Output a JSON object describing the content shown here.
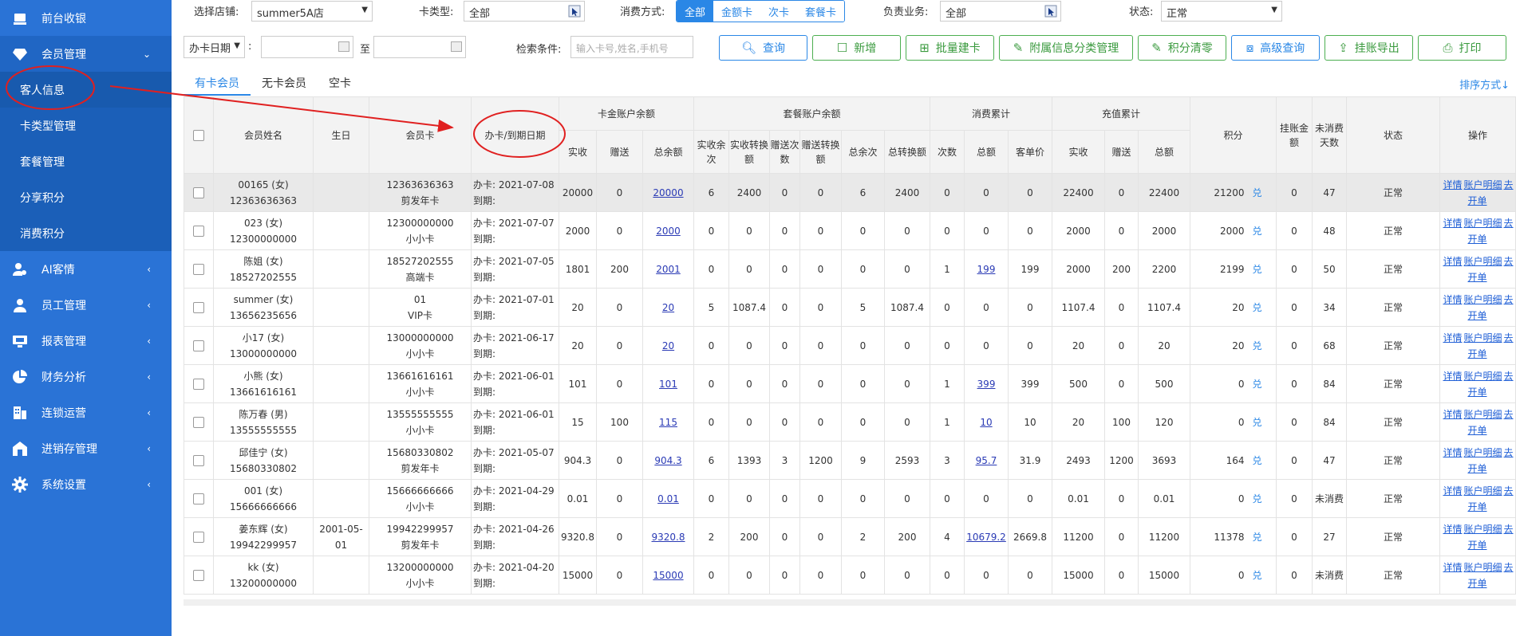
{
  "sidebar": {
    "items": [
      {
        "label": "前台收银",
        "icon": "cashier-icon"
      },
      {
        "label": "会员管理",
        "icon": "diamond-icon",
        "chev": "⌄"
      },
      {
        "label": "AI客情",
        "icon": "user-gear-icon",
        "chev": "‹"
      },
      {
        "label": "员工管理",
        "icon": "person-icon",
        "chev": "‹"
      },
      {
        "label": "报表管理",
        "icon": "monitor-icon",
        "chev": "‹"
      },
      {
        "label": "财务分析",
        "icon": "pie-icon",
        "chev": "‹"
      },
      {
        "label": "连锁运营",
        "icon": "building-icon",
        "chev": "‹"
      },
      {
        "label": "进销存管理",
        "icon": "house-icon",
        "chev": "‹"
      },
      {
        "label": "系统设置",
        "icon": "gear-icon",
        "chev": "‹"
      }
    ],
    "sub": [
      "客人信息",
      "卡类型管理",
      "套餐管理",
      "分享积分",
      "消费积分"
    ]
  },
  "filters": {
    "store_label": "选择店铺:",
    "store_value": "summer5A店",
    "cardtype_label": "卡类型:",
    "cardtype_value": "全部",
    "paymode_label": "消费方式:",
    "paymodes": [
      "全部",
      "金额卡",
      "次卡",
      "套餐卡"
    ],
    "staff_label": "负责业务:",
    "staff_value": "全部",
    "status_label": "状态:",
    "status_value": "正常",
    "date_type": "办卡日期",
    "date_colon": ":",
    "date_to": "至",
    "search_label": "检索条件:",
    "search_placeholder": "输入卡号,姓名,手机号"
  },
  "buttons": [
    "查询",
    "新增",
    "批量建卡",
    "附属信息分类管理",
    "积分清零",
    "高级查询",
    "挂账导出",
    "打印"
  ],
  "tabs": [
    "有卡会员",
    "无卡会员",
    "空卡"
  ],
  "sort_label": "排序方式↓",
  "table": {
    "h1": {
      "name": "会员姓名",
      "birth": "生日",
      "card": "会员卡",
      "date": "办卡/到期日期",
      "cardbal": "卡金账户余额",
      "pkgbal": "套餐账户余额",
      "consume": "消费累计",
      "recharge": "充值累计",
      "points": "积分",
      "credit": "挂账金额",
      "unused": "未消费天数",
      "status": "状态",
      "ops": "操作"
    },
    "h2": [
      "实收",
      "赠送",
      "总余额",
      "实收余次",
      "实收转换额",
      "赠送次数",
      "赠送转换额",
      "总余次",
      "总转换额",
      "次数",
      "总额",
      "客单价",
      "实收",
      "赠送",
      "总额"
    ],
    "date_prefix_open": "办卡:",
    "date_prefix_exp": "到期:",
    "ops": [
      "详情",
      "账户明细",
      "去开单"
    ],
    "points_suffix": "兑",
    "rows": [
      {
        "name": "00165 (女)",
        "phone": "12363636363",
        "birth": "",
        "card": "12363636363",
        "ctype": "剪发年卡",
        "open": "2021-07-08",
        "c": [
          "20000",
          "0",
          "20000",
          "6",
          "2400",
          "0",
          "0",
          "6",
          "2400",
          "0",
          "0",
          "0",
          "22400",
          "0",
          "22400"
        ],
        "pts": "21200",
        "credit": "0",
        "unused": "47",
        "status": "正常"
      },
      {
        "name": "023 (女)",
        "phone": "12300000000",
        "birth": "",
        "card": "12300000000",
        "ctype": "小小卡",
        "open": "2021-07-07",
        "c": [
          "2000",
          "0",
          "2000",
          "0",
          "0",
          "0",
          "0",
          "0",
          "0",
          "0",
          "0",
          "0",
          "2000",
          "0",
          "2000"
        ],
        "pts": "2000",
        "credit": "0",
        "unused": "48",
        "status": "正常"
      },
      {
        "name": "陈姐 (女)",
        "phone": "18527202555",
        "birth": "",
        "card": "18527202555",
        "ctype": "高端卡",
        "open": "2021-07-05",
        "c": [
          "1801",
          "200",
          "2001",
          "0",
          "0",
          "0",
          "0",
          "0",
          "0",
          "1",
          "199",
          "199",
          "2000",
          "200",
          "2200"
        ],
        "pts": "2199",
        "credit": "0",
        "unused": "50",
        "status": "正常"
      },
      {
        "name": "summer (女)",
        "phone": "13656235656",
        "birth": "",
        "card": "01",
        "ctype": "VIP卡",
        "open": "2021-07-01",
        "c": [
          "20",
          "0",
          "20",
          "5",
          "1087.4",
          "0",
          "0",
          "5",
          "1087.4",
          "0",
          "0",
          "0",
          "1107.4",
          "0",
          "1107.4"
        ],
        "pts": "20",
        "credit": "0",
        "unused": "34",
        "status": "正常"
      },
      {
        "name": "小17 (女)",
        "phone": "13000000000",
        "birth": "",
        "card": "13000000000",
        "ctype": "小小卡",
        "open": "2021-06-17",
        "c": [
          "20",
          "0",
          "20",
          "0",
          "0",
          "0",
          "0",
          "0",
          "0",
          "0",
          "0",
          "0",
          "20",
          "0",
          "20"
        ],
        "pts": "20",
        "credit": "0",
        "unused": "68",
        "status": "正常"
      },
      {
        "name": "小熊 (女)",
        "phone": "13661616161",
        "birth": "",
        "card": "13661616161",
        "ctype": "小小卡",
        "open": "2021-06-01",
        "c": [
          "101",
          "0",
          "101",
          "0",
          "0",
          "0",
          "0",
          "0",
          "0",
          "1",
          "399",
          "399",
          "500",
          "0",
          "500"
        ],
        "pts": "0",
        "credit": "0",
        "unused": "84",
        "status": "正常"
      },
      {
        "name": "陈万春 (男)",
        "phone": "13555555555",
        "birth": "",
        "card": "13555555555",
        "ctype": "小小卡",
        "open": "2021-06-01",
        "c": [
          "15",
          "100",
          "115",
          "0",
          "0",
          "0",
          "0",
          "0",
          "0",
          "1",
          "10",
          "10",
          "20",
          "100",
          "120"
        ],
        "pts": "0",
        "credit": "0",
        "unused": "84",
        "status": "正常"
      },
      {
        "name": "邱佳宁 (女)",
        "phone": "15680330802",
        "birth": "",
        "card": "15680330802",
        "ctype": "剪发年卡",
        "open": "2021-05-07",
        "c": [
          "904.3",
          "0",
          "904.3",
          "6",
          "1393",
          "3",
          "1200",
          "9",
          "2593",
          "3",
          "95.7",
          "31.9",
          "2493",
          "1200",
          "3693"
        ],
        "pts": "164",
        "credit": "0",
        "unused": "47",
        "status": "正常"
      },
      {
        "name": "001 (女)",
        "phone": "15666666666",
        "birth": "",
        "card": "15666666666",
        "ctype": "小小卡",
        "open": "2021-04-29",
        "c": [
          "0.01",
          "0",
          "0.01",
          "0",
          "0",
          "0",
          "0",
          "0",
          "0",
          "0",
          "0",
          "0",
          "0.01",
          "0",
          "0.01"
        ],
        "pts": "0",
        "credit": "0",
        "unused": "未消费",
        "status": "正常"
      },
      {
        "name": "姜东辉 (女)",
        "phone": "19942299957",
        "birth": "2001-05-01",
        "card": "19942299957",
        "ctype": "剪发年卡",
        "open": "2021-04-26",
        "c": [
          "9320.8",
          "0",
          "9320.8",
          "2",
          "200",
          "0",
          "0",
          "2",
          "200",
          "4",
          "10679.2",
          "2669.8",
          "11200",
          "0",
          "11200"
        ],
        "pts": "11378",
        "credit": "0",
        "unused": "27",
        "status": "正常"
      },
      {
        "name": "kk (女)",
        "phone": "13200000000",
        "birth": "",
        "card": "13200000000",
        "ctype": "小小卡",
        "open": "2021-04-20",
        "c": [
          "15000",
          "0",
          "15000",
          "0",
          "0",
          "0",
          "0",
          "0",
          "0",
          "0",
          "0",
          "0",
          "15000",
          "0",
          "15000"
        ],
        "pts": "0",
        "credit": "0",
        "unused": "未消费",
        "status": "正常"
      }
    ]
  },
  "colors": {
    "sidebar": "#2a73d6",
    "accent": "#2a87e6",
    "annotation": "#e02020"
  }
}
